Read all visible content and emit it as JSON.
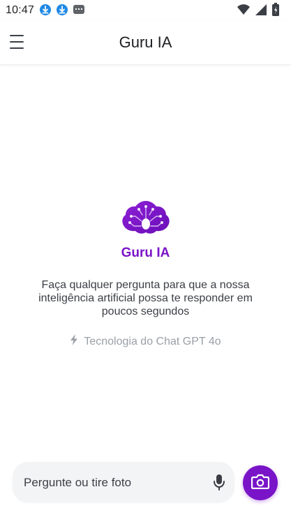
{
  "status_bar": {
    "time": "10:47",
    "notifications": [
      "download-icon",
      "download-icon",
      "sms-icon"
    ],
    "right_icons": [
      "wifi-icon",
      "signal-icon",
      "battery-icon"
    ]
  },
  "app_bar": {
    "title": "Guru IA",
    "menu_icon": "menu-icon"
  },
  "hero": {
    "logo_icon": "brain-circuit-icon",
    "brand_name": "Guru IA",
    "description": "Faça qualquer pergunta para que a nossa inteligência artificial possa te responder em poucos segundos",
    "tech_note": "Tecnologia do Chat GPT 4o",
    "tech_icon": "lightning-icon"
  },
  "composer": {
    "placeholder": "Pergunte ou tire foto",
    "value": "",
    "mic_icon": "microphone-icon",
    "camera_icon": "camera-icon"
  },
  "colors": {
    "accent": "#7a14c8",
    "muted_text": "#9aa0a6",
    "body_text": "#3b3f45",
    "input_bg": "#f3f4f6"
  }
}
